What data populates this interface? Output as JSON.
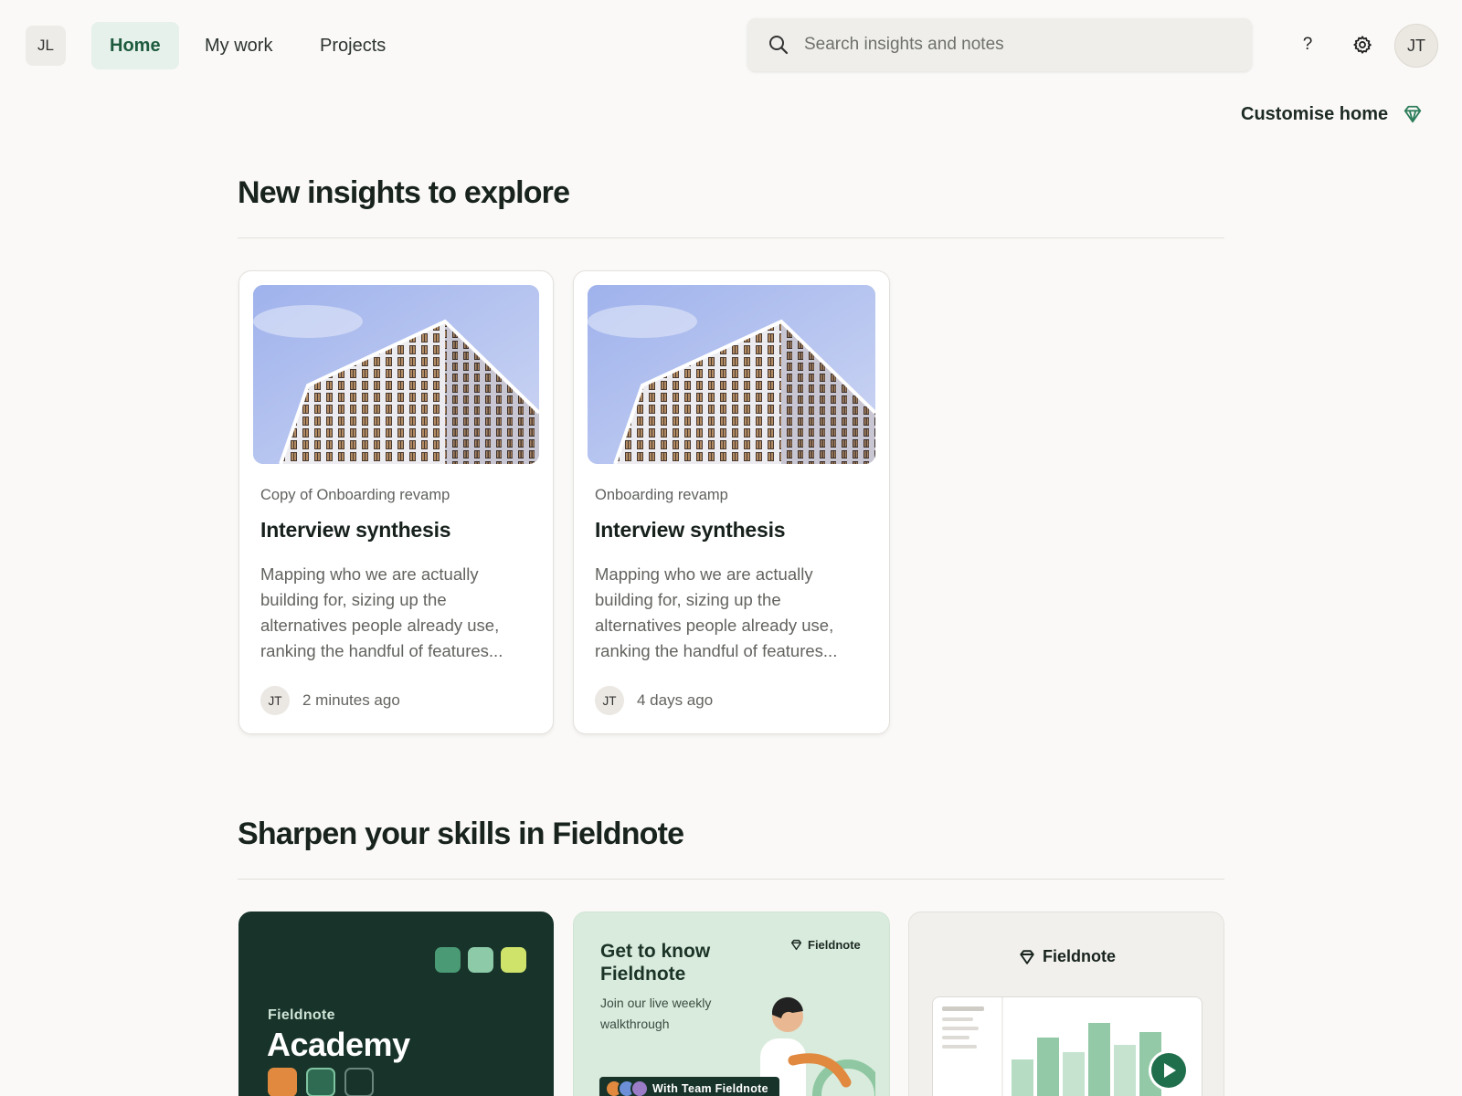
{
  "header": {
    "workspace_initials": "JL",
    "nav": [
      {
        "label": "Home",
        "active": true
      },
      {
        "label": "My work",
        "active": false
      },
      {
        "label": "Projects",
        "active": false
      }
    ],
    "search_placeholder": "Search insights and notes",
    "help_label": "?",
    "user_initials": "JT",
    "customise_label": "Customise home",
    "accent_color": "#2e7d5b"
  },
  "insights": {
    "title": "New insights to explore",
    "cards": [
      {
        "project": "Copy of Onboarding revamp",
        "title": "Interview synthesis",
        "description": "Mapping who we are actually building for, sizing up the alternatives people already use, ranking the handful of features...",
        "author_initials": "JT",
        "time": "2 minutes ago"
      },
      {
        "project": "Onboarding revamp",
        "title": "Interview synthesis",
        "description": "Mapping who we are actually building for, sizing up the alternatives people already use, ranking the handful of features...",
        "author_initials": "JT",
        "time": "4 days ago"
      }
    ]
  },
  "skills": {
    "title": "Sharpen your skills in Fieldnote",
    "academy": {
      "brand": "Fieldnote",
      "title": "Academy"
    },
    "know": {
      "title": "Get to know Fieldnote",
      "subtitle": "Join our live weekly walkthrough",
      "brand": "Fieldnote",
      "pill": "With Team Fieldnote"
    },
    "demo": {
      "brand": "Fieldnote"
    }
  }
}
